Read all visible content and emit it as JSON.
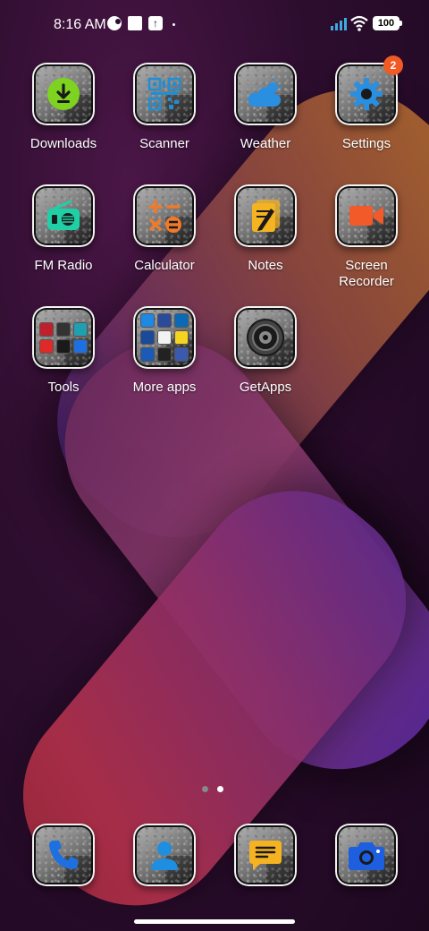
{
  "status_bar": {
    "time": "8:16 AM",
    "battery": "100",
    "icons": [
      "data-saver-icon",
      "gallery-icon",
      "upload-icon",
      "notification-dot-icon",
      "signal-icon",
      "wifi-icon",
      "battery-icon"
    ]
  },
  "apps": [
    {
      "name": "downloads",
      "label": "Downloads",
      "icon": "download-icon",
      "color": "#7ed321"
    },
    {
      "name": "scanner",
      "label": "Scanner",
      "icon": "qr-code-icon",
      "color": "#1e8fd6"
    },
    {
      "name": "weather",
      "label": "Weather",
      "icon": "cloud-sun-icon",
      "color": "#2a8fe0"
    },
    {
      "name": "settings",
      "label": "Settings",
      "icon": "gear-icon",
      "color": "#2a8fe0",
      "badge": "2"
    },
    {
      "name": "fm-radio",
      "label": "FM Radio",
      "icon": "radio-icon",
      "color": "#1fd0a6"
    },
    {
      "name": "calculator",
      "label": "Calculator",
      "icon": "calculator-icon",
      "color": "#f07a2a"
    },
    {
      "name": "notes",
      "label": "Notes",
      "icon": "notes-icon",
      "color": "#f5b321"
    },
    {
      "name": "screen-recorder",
      "label": "Screen\nRecorder",
      "icon": "video-camera-icon",
      "color": "#f25a2a"
    },
    {
      "name": "tools",
      "label": "Tools",
      "icon": "folder-icon"
    },
    {
      "name": "more-apps",
      "label": "More apps",
      "icon": "folder-icon"
    },
    {
      "name": "getapps",
      "label": "GetApps",
      "icon": "lens-icon"
    }
  ],
  "dock": [
    {
      "name": "phone",
      "icon": "phone-icon",
      "color": "#1e6fe0"
    },
    {
      "name": "contacts",
      "icon": "contacts-icon",
      "color": "#1e8fe0"
    },
    {
      "name": "messages",
      "icon": "message-icon",
      "color": "#f5b321"
    },
    {
      "name": "camera",
      "icon": "camera-icon",
      "color": "#1e5fe0"
    }
  ],
  "page_indicator": {
    "total": 2,
    "active": 2
  }
}
